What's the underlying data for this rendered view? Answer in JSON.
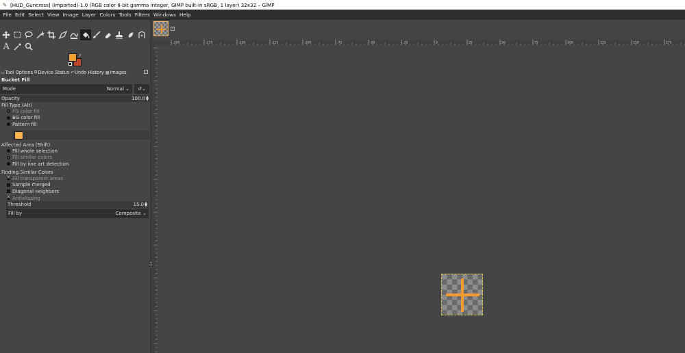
{
  "window": {
    "title": "[HUD_Guncross] (imported)-1.0 (RGB color 8-bit gamma integer, GIMP built-in sRGB, 1 layer) 32x32 – GIMP"
  },
  "menu": [
    "File",
    "Edit",
    "Select",
    "View",
    "Image",
    "Layer",
    "Colors",
    "Tools",
    "Filters",
    "Windows",
    "Help"
  ],
  "colors": {
    "foreground": "#f59f2e",
    "background": "#c0482a"
  },
  "tabs": [
    {
      "label": "Tool Options",
      "icon": "tool-options-icon"
    },
    {
      "label": "Device Status",
      "icon": "device-status-icon"
    },
    {
      "label": "Undo History",
      "icon": "undo-history-icon"
    },
    {
      "label": "Images",
      "icon": "images-icon"
    }
  ],
  "tool_options": {
    "title": "Bucket Fill",
    "mode_label": "Mode",
    "mode_value": "Normal",
    "opacity_label": "Opacity",
    "opacity_value": "100.0",
    "fill_type_label": "Fill Type  (Alt)",
    "fill_types": [
      "FG color fill",
      "BG color fill",
      "Pattern fill"
    ],
    "affected_area_label": "Affected Area  (Shift)",
    "affected_areas": [
      "Fill whole selection",
      "Fill similar colors",
      "Fill by line art detection"
    ],
    "finding_label": "Finding Similar Colors",
    "finding_options": [
      "Fill transparent areas",
      "Sample merged",
      "Diagonal neighbors",
      "Antialiasing"
    ],
    "threshold_label": "Threshold",
    "threshold_value": "15.0",
    "fill_by_label": "Fill by",
    "fill_by_value": "Composite"
  },
  "ruler": {
    "ticks": [
      "-200",
      "-175",
      "-150",
      "-125",
      "-100",
      "-75",
      "-50",
      "-25",
      "0",
      "25",
      "50",
      "75",
      "100",
      "125",
      "150",
      "175"
    ]
  }
}
